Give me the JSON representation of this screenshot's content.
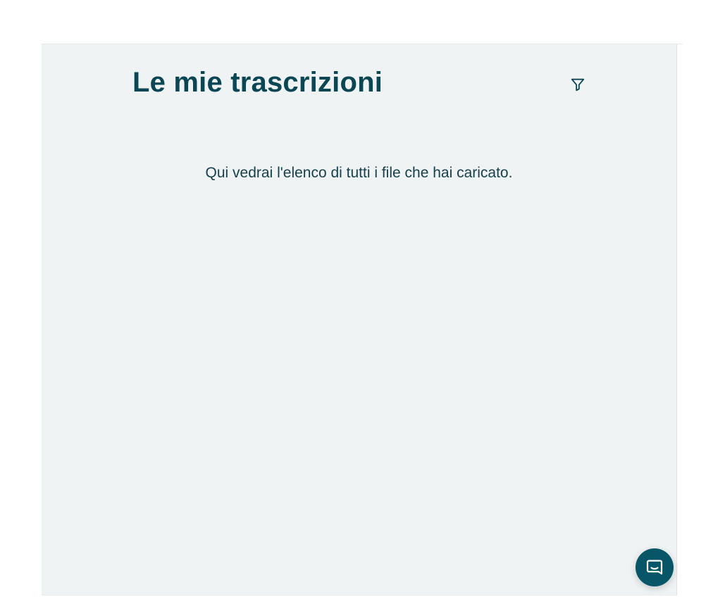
{
  "page": {
    "title": "Le mie trascrizioni",
    "empty_message": "Qui vedrai l'elenco di tutti i file che hai caricato."
  },
  "icons": {
    "filter": "filter-icon",
    "chat": "chat-icon"
  },
  "colors": {
    "primary": "#0b4654",
    "panel_bg": "#eff3f4",
    "launcher_bg": "#075667"
  }
}
